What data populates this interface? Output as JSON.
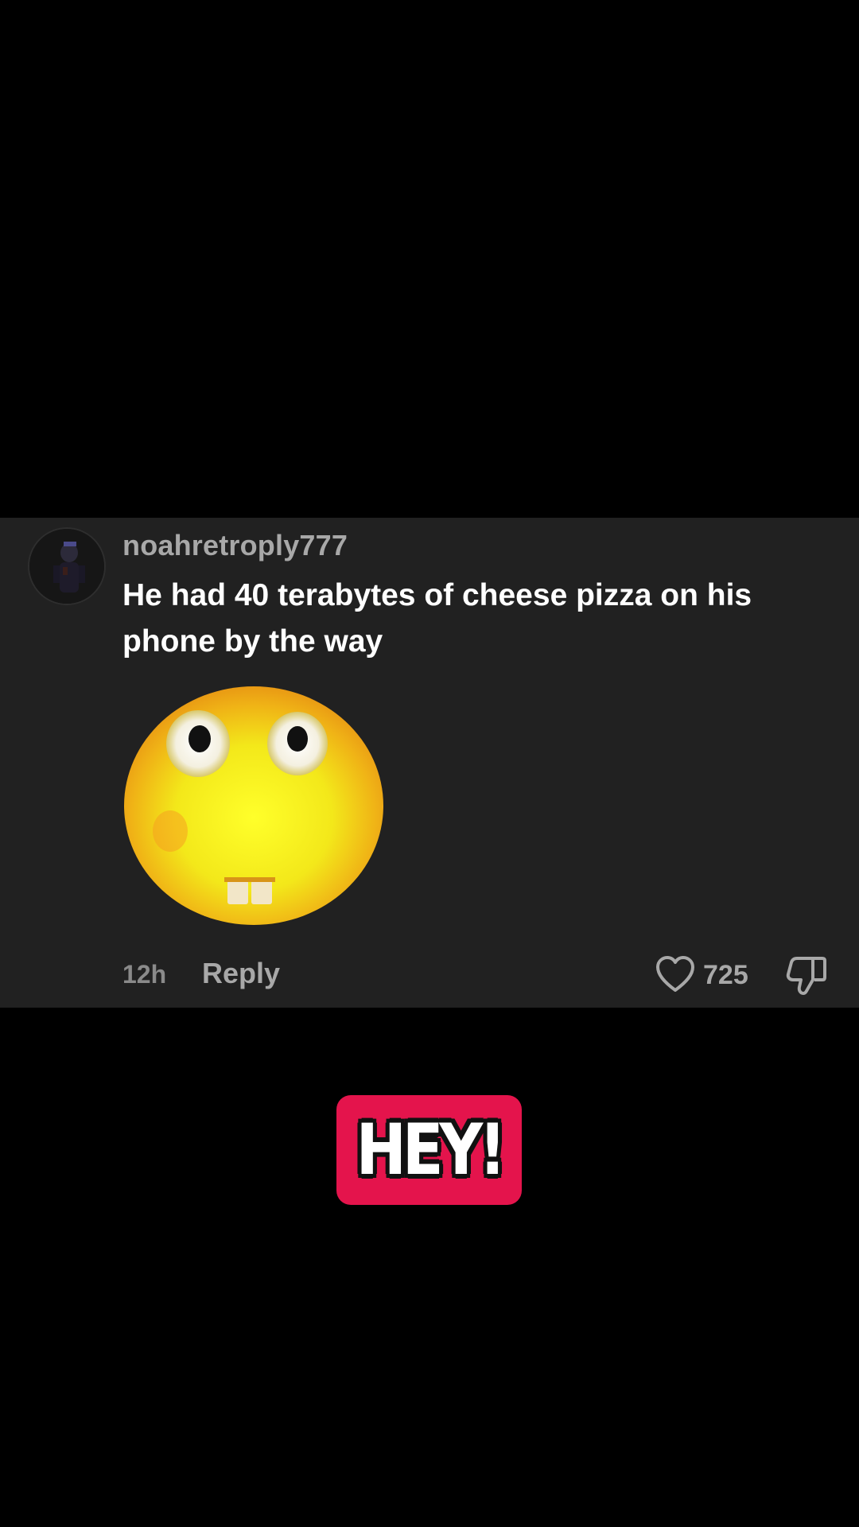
{
  "comment": {
    "username": "noahretroply777",
    "text": "He had 40 terabytes of cheese pizza on his phone by the way",
    "sticker_icon": "surprised-emoji-sticker",
    "timestamp": "12h",
    "reply_label": "Reply",
    "like_count": "725",
    "like_icon": "heart-outline-icon",
    "dislike_icon": "thumbs-down-icon"
  },
  "overlay": {
    "label": "HEY!",
    "badge_color": "#e4144c"
  },
  "colors": {
    "background": "#000000",
    "card": "#212121",
    "primary_text": "#ffffff",
    "secondary_text": "#a8a8a8"
  }
}
